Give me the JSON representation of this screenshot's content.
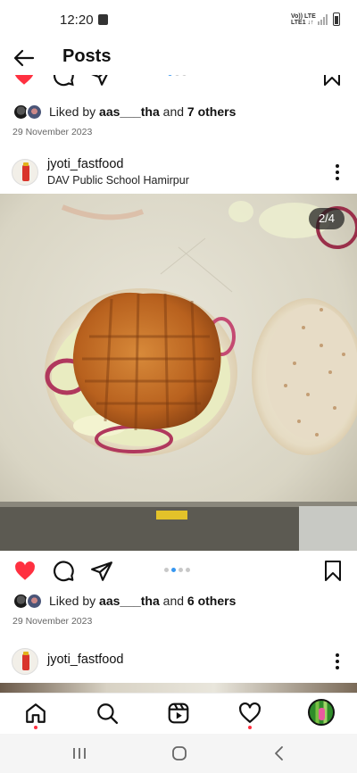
{
  "status_bar": {
    "time": "12:20",
    "network_line1": "Vo)) LTE",
    "network_line2": "LTE1 ↓↑"
  },
  "header": {
    "title": "Posts"
  },
  "posts": [
    {
      "likes": {
        "prefix": "Liked by ",
        "user": "aas___tha",
        "middle": " and ",
        "others": "7 others"
      },
      "date": "29 November 2023"
    },
    {
      "username": "jyoti_fastfood",
      "location": "DAV Public School Hamirpur",
      "image_counter": "2/4",
      "carousel": {
        "total": 4,
        "active_index": 1
      },
      "liked": true,
      "likes": {
        "prefix": "Liked by ",
        "user": "aas___tha",
        "middle": " and ",
        "others": "6 others"
      },
      "date": "29 November 2023"
    },
    {
      "username": "jyoti_fastfood"
    }
  ],
  "colors": {
    "like_red": "#ff3040",
    "accent_blue": "#3797f0",
    "text": "#111111"
  },
  "bottom_nav": [
    "home-icon",
    "search-icon",
    "reels-icon",
    "activity-heart-icon",
    "profile-avatar"
  ],
  "system_nav": [
    "recents-icon",
    "home-button-icon",
    "back-icon"
  ]
}
